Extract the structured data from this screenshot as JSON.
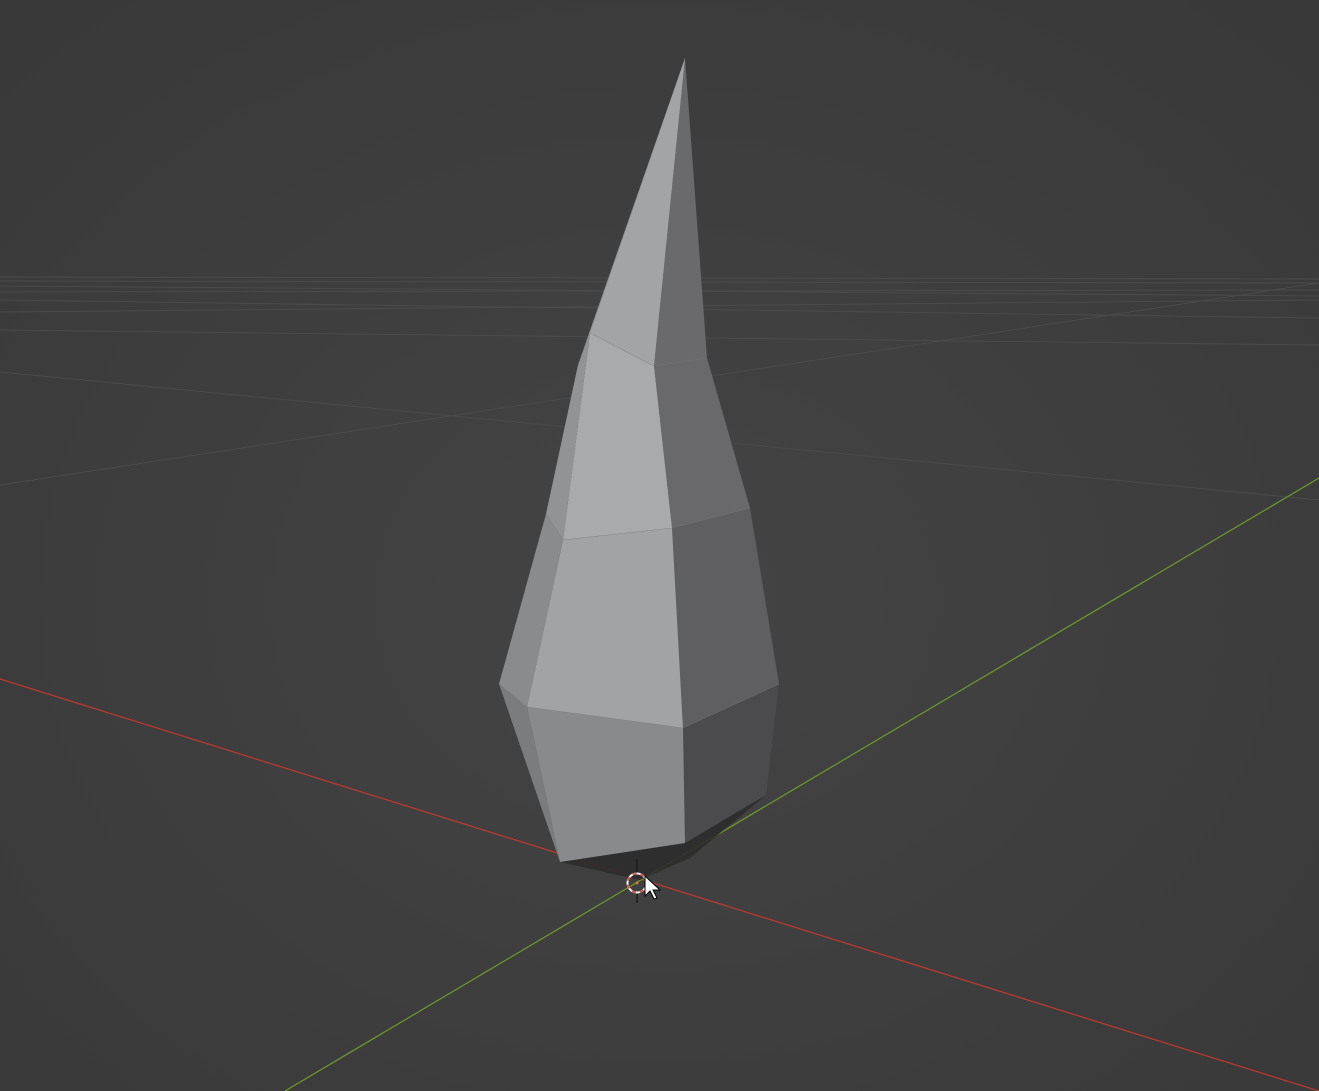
{
  "viewport": {
    "kind": "3d-viewport",
    "background_color": "#3d3d3d",
    "background_center_color": "#444444",
    "grid_line_color": "#4a4a4a",
    "x_axis_color": "#c0392f",
    "y_axis_color": "#6f9a2c"
  },
  "scene_object": {
    "shape": "low-poly tapered spike",
    "light_face_color": "#a4a5a7",
    "mid_face_color": "#8c8d8f",
    "dark_face_color": "#5e5e60",
    "shadow_color": "#2e2e2e"
  },
  "cursor_3d": {
    "icon": "3d-cursor-icon",
    "ring_colors": [
      "#d9534f",
      "#ffffff"
    ]
  },
  "mouse_pointer": {
    "icon": "mouse-pointer-icon"
  }
}
